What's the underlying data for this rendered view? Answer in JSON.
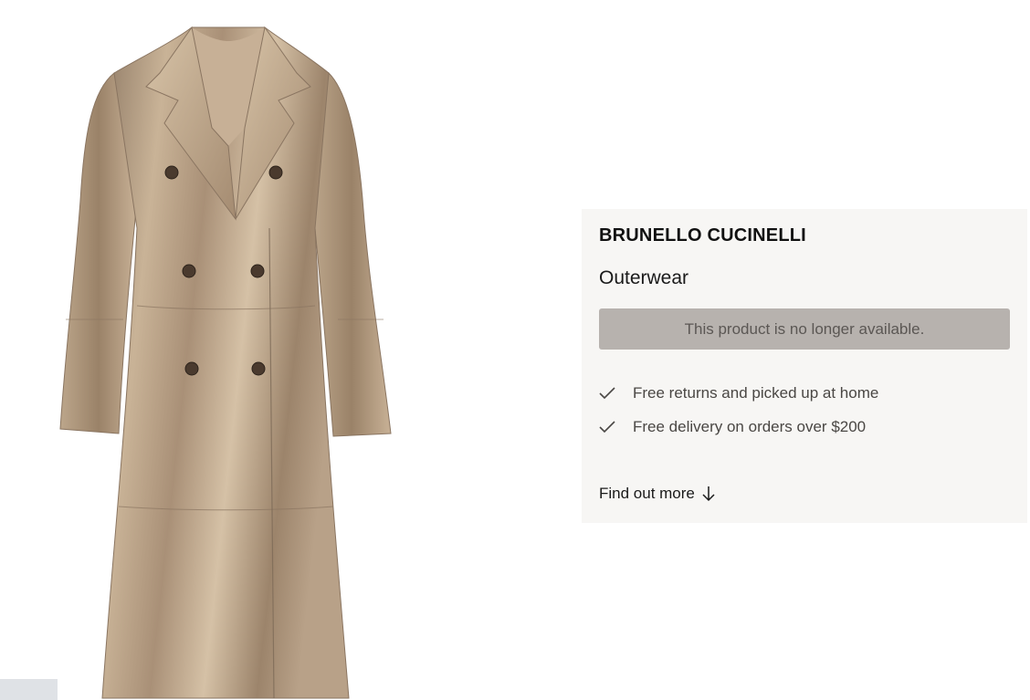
{
  "product": {
    "image_alt": "Metallic leather double-breasted long coat",
    "brand": "BRUNELLO CUCINELLI",
    "category": "Outerwear",
    "availability_message": "This product is no longer available."
  },
  "perks": [
    {
      "icon": "check-icon",
      "label": "Free returns and picked up at home"
    },
    {
      "icon": "check-icon",
      "label": "Free delivery on orders over $200"
    }
  ],
  "find_more": {
    "label": "Find out more",
    "icon": "arrow-down-icon"
  },
  "colors": {
    "panel_bg": "#f7f6f4",
    "unavailable_bg": "#b7b2ae",
    "coat_base": "#b39c82",
    "coat_highlight": "#d9c6ad",
    "coat_shadow": "#8a7561"
  }
}
